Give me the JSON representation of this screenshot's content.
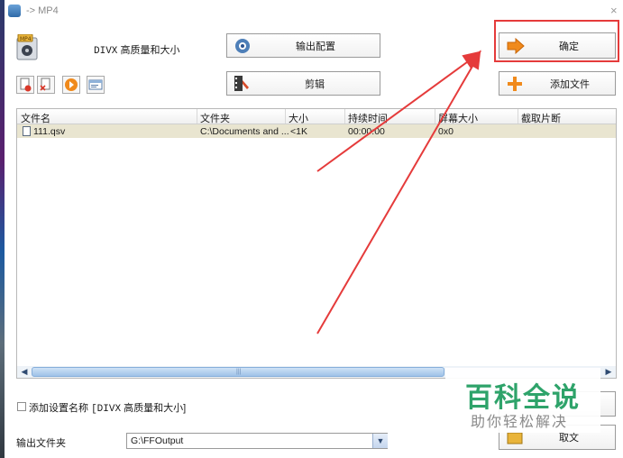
{
  "window": {
    "title": "-> MP4"
  },
  "profile": {
    "name_mono": "DIVX",
    "name_text": "高质量和大小"
  },
  "buttons": {
    "output_config": "输出配置",
    "edit": "剪辑",
    "ok": "确定",
    "add_file": "添加文件",
    "cancel": "取文"
  },
  "table": {
    "columns": [
      "文件名",
      "文件夹",
      "大小",
      "持续时间",
      "屏幕大小",
      "截取片断"
    ],
    "rows": [
      {
        "name": "111.qsv",
        "folder": "C:\\Documents and ...",
        "size": "<1K",
        "duration": "00:00:00",
        "screen": "0x0",
        "clip": ""
      }
    ]
  },
  "options": {
    "add_name_label": "添加设置名称",
    "add_name_value_mono": "[DIVX",
    "add_name_value_text": "高质量和大小]"
  },
  "output": {
    "label": "输出文件夹",
    "value": "G:\\FFOutput"
  },
  "watermark": {
    "main": "百科全说",
    "sub": "助你轻松解决"
  },
  "colors": {
    "highlight": "#e53b3b",
    "watermark_green": "#2ea36a"
  }
}
